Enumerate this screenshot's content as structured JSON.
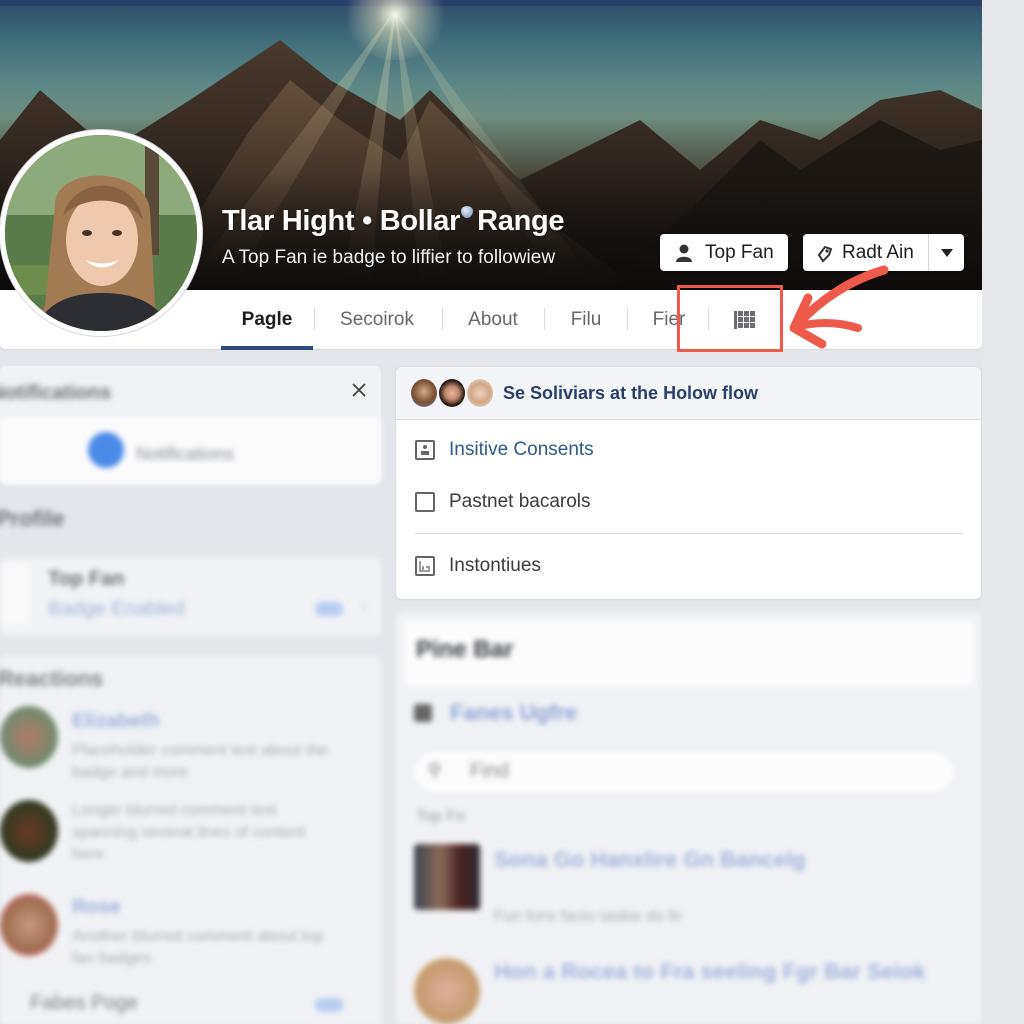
{
  "profile": {
    "name_part1": "Tlar Hight • Bollar",
    "name_part2": "Range",
    "subtitle": "A Top Fan ie badge to liffier to followiew"
  },
  "cover_buttons": {
    "top_fan_label": "Top Fan",
    "radt_label": "Radt Ain"
  },
  "tabs": [
    {
      "label": "Pagle",
      "active": true
    },
    {
      "label": "Secoirok",
      "active": false
    },
    {
      "label": "About",
      "active": false
    },
    {
      "label": "Filu",
      "active": false
    },
    {
      "label": "Fier",
      "active": false
    }
  ],
  "tab_grid_icon": "grid-icon",
  "annotation": {
    "highlight_color": "#ee5a4a",
    "target": "grid-icon tab"
  },
  "feature_card": {
    "title": "Se Soliviars at the Holow flow",
    "options": [
      {
        "label": "Insitive Consents",
        "icon": "person-badge-icon",
        "link": true
      },
      {
        "label": "Pastnet bacarols",
        "icon": "checkbox-icon",
        "link": false
      },
      {
        "label": "Instontiues",
        "icon": "image-frame-icon",
        "link": false
      }
    ]
  },
  "left_column": {
    "notification_header": "Notifications",
    "notification_line": "Notifications",
    "section_title": "Profile",
    "top_fan_title": "Top Fan",
    "top_fan_subtitle": "Badge Enabled",
    "friends_title": "Reactions",
    "friends": [
      {
        "name": "Elizabeth",
        "text": "Placeholder comment text about the badge and more"
      },
      {
        "name": "",
        "text": "Longer blurred comment text spanning several lines of content here"
      },
      {
        "name": "Rose",
        "text": "Another blurred comment about top fan badges"
      }
    ],
    "footer_label": "Fabes Poge"
  },
  "right_lower": {
    "title": "Pine Bar",
    "link_label": "Fanes Ugfre",
    "search_placeholder": "Find",
    "sub_label": "Top Fo",
    "items": [
      {
        "title": "Sona Go Hanxlire Gn Bancelg",
        "sub": "Fun fons facto taskie do fe"
      },
      {
        "title": "Hon a Rocea to Fra seeling Fgr Bar Seiok",
        "sub": ""
      }
    ]
  },
  "colors": {
    "accent_navy": "#2c4a7d",
    "link_blue": "#2d5a8c",
    "page_bg": "#e4e6eb"
  }
}
